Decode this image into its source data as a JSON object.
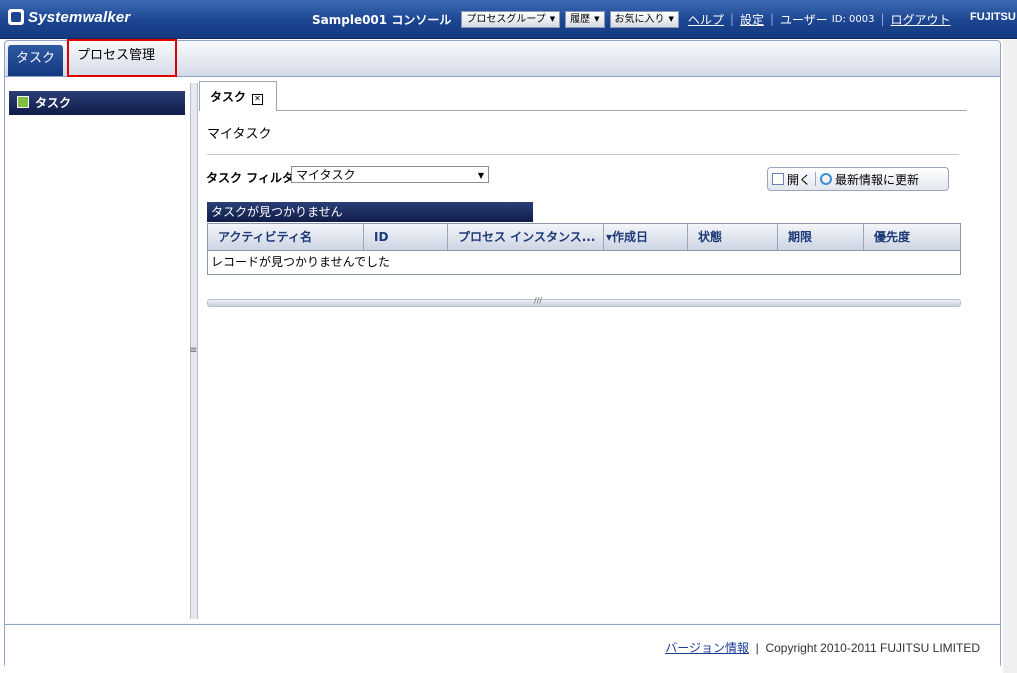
{
  "header": {
    "logo": "Systemwalker",
    "console": "Sample001 コンソール",
    "dropdowns": [
      "プロセスグループ",
      "履歴",
      "お気に入り"
    ],
    "help": "ヘルプ",
    "settings": "設定",
    "user_label": "ユーザー",
    "user_id": "ID: 0003",
    "logout": "ログアウト",
    "brand": "FUJITSU"
  },
  "tabs": [
    {
      "label": "タスク",
      "active": true
    },
    {
      "label": "プロセス管理",
      "active": false
    }
  ],
  "leftnav": {
    "item": "タスク"
  },
  "panel": {
    "tab_label": "タスク",
    "title": "マイタスク",
    "filter_label": "タスク フィルタ",
    "filter_value": "マイタスク",
    "open_button": "開く",
    "refresh_button": "最新情報に更新",
    "status_bar": "タスクが見つかりません",
    "columns": [
      "アクティビティ名",
      "ID",
      "プロセス インスタンス...",
      "▾作成日",
      "状態",
      "期限",
      "優先度"
    ],
    "empty_message": "レコードが見つかりませんでした"
  },
  "footer": {
    "version_link": "バージョン情報",
    "copyright": "Copyright 2010-2011 FUJITSU LIMITED"
  }
}
